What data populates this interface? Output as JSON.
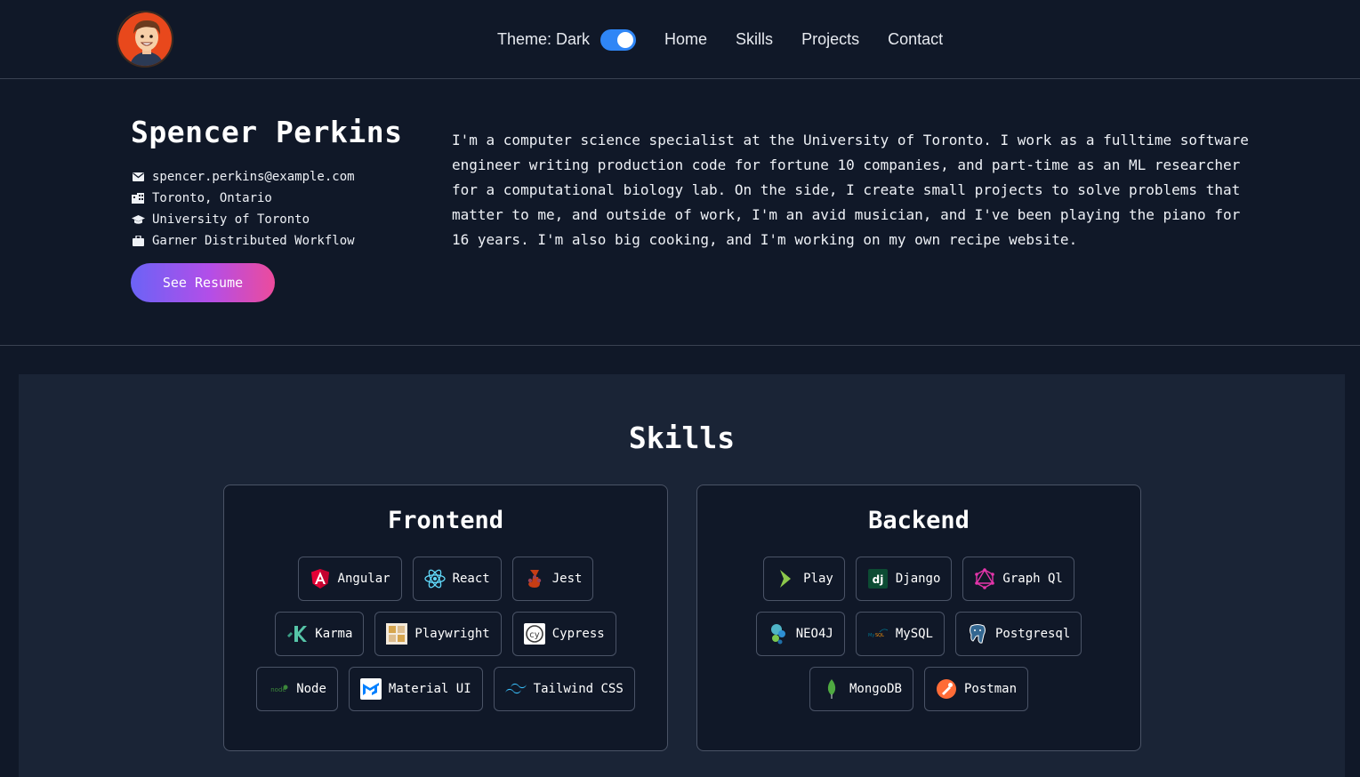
{
  "header": {
    "theme_label": "Theme: Dark",
    "nav": [
      "Home",
      "Skills",
      "Projects",
      "Contact"
    ]
  },
  "profile": {
    "name": "Spencer Perkins",
    "email": "spencer.perkins@example.com",
    "location": "Toronto, Ontario",
    "school": "University of Toronto",
    "work": "Garner Distributed Workflow",
    "resume_button": "See Resume",
    "bio": "I'm a computer science specialist at the University of Toronto. I work as a fulltime software engineer writing production code for fortune 10 companies, and part-time as an ML researcher for a computational biology lab. On the side, I create small projects to solve problems that matter to me, and outside of work, I'm an avid musician, and I've been playing the piano for 16 years. I'm also big cooking, and I'm working on my own recipe website."
  },
  "skills": {
    "title": "Skills",
    "frontend": {
      "title": "Frontend",
      "rows": [
        [
          {
            "label": "Angular",
            "icon": "angular-icon"
          },
          {
            "label": "React",
            "icon": "react-icon"
          },
          {
            "label": "Jest",
            "icon": "jest-icon"
          }
        ],
        [
          {
            "label": "Karma",
            "icon": "karma-icon"
          },
          {
            "label": "Playwright",
            "icon": "playwright-icon"
          },
          {
            "label": "Cypress",
            "icon": "cypress-icon"
          }
        ],
        [
          {
            "label": "Node",
            "icon": "node-icon"
          },
          {
            "label": "Material UI",
            "icon": "material-ui-icon"
          },
          {
            "label": "Tailwind CSS",
            "icon": "tailwind-icon"
          }
        ]
      ]
    },
    "backend": {
      "title": "Backend",
      "rows": [
        [
          {
            "label": "Play",
            "icon": "play-icon"
          },
          {
            "label": "Django",
            "icon": "django-icon"
          },
          {
            "label": "Graph Ql",
            "icon": "graphql-icon"
          }
        ],
        [
          {
            "label": "NEO4J",
            "icon": "neo4j-icon"
          },
          {
            "label": "MySQL",
            "icon": "mysql-icon"
          },
          {
            "label": "Postgresql",
            "icon": "postgresql-icon"
          }
        ],
        [
          {
            "label": "MongoDB",
            "icon": "mongodb-icon"
          },
          {
            "label": "Postman",
            "icon": "postman-icon"
          }
        ]
      ]
    }
  },
  "colors": {
    "background": "#101828",
    "section": "#1a2436",
    "accent": "#2f86f6",
    "gradient_start": "#6b63f6",
    "gradient_end": "#ec4b9c"
  }
}
